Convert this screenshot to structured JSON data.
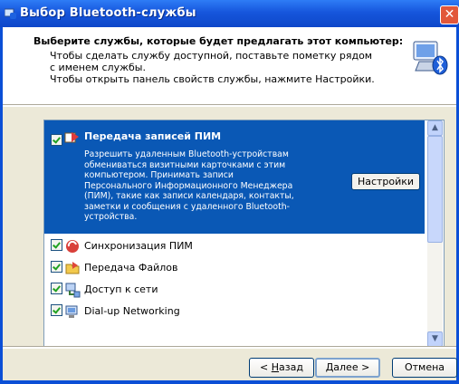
{
  "window": {
    "title": "Выбор Bluetooth-службы",
    "close_glyph": "✕"
  },
  "header": {
    "title": "Выберите службы, которые будет предлагать этот компьютер:",
    "line1": "Чтобы сделать службу доступной, поставьте пометку рядом с именем службы.",
    "line2": "Чтобы открыть панель свойств службы, нажмите Настройки."
  },
  "services": {
    "selected": {
      "label": "Передача записей ПИМ",
      "description": "Разрешить удаленным Bluetooth-устройствам обмениваться визитными карточками с этим компьютером. Принимать записи Персонального Информационного Менеджера (ПИМ), такие как записи календаря, контакты, заметки и сообщения с удаленного Bluetooth-устройства.",
      "checked": true,
      "icon": "pim-transfer-icon"
    },
    "settings_button": "Настройки",
    "items": [
      {
        "label": "Синхронизация ПИМ",
        "checked": true,
        "icon": "pim-sync-icon"
      },
      {
        "label": "Передача Файлов",
        "checked": true,
        "icon": "file-transfer-icon"
      },
      {
        "label": "Доступ к сети",
        "checked": true,
        "icon": "network-access-icon"
      },
      {
        "label": "Dial-up Networking",
        "checked": true,
        "icon": "dialup-icon"
      }
    ]
  },
  "buttons": {
    "back_prefix": "< ",
    "back_mnemonic": "Н",
    "back_rest": "азад",
    "next_mnemonic": "Д",
    "next_rest": "алее >",
    "cancel": "Отмена"
  },
  "colors": {
    "title_bar": "#0b4fd6",
    "selection": "#0a58b5",
    "dialog_face": "#ece9d8"
  }
}
